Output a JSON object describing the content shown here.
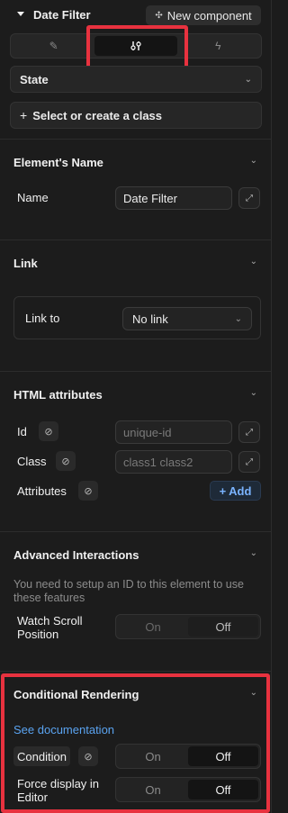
{
  "header": {
    "title": "Date Filter",
    "new_component_label": "New component",
    "new_component_icon": "sparkle-icon"
  },
  "tabs": [
    {
      "icon": "pencil-icon",
      "glyph": "✎",
      "active": false
    },
    {
      "icon": "sliders-icon",
      "glyph": "⫶",
      "active": true
    },
    {
      "icon": "lightning-icon",
      "glyph": "ϟ",
      "active": false
    }
  ],
  "state_select": {
    "label": "State"
  },
  "class_select": {
    "plus": "+",
    "label": "Select or create a class"
  },
  "element_name": {
    "title": "Element's Name",
    "name_label": "Name",
    "name_value": "Date Filter"
  },
  "link": {
    "title": "Link",
    "link_to_label": "Link to",
    "link_to_value": "No link"
  },
  "html_attributes": {
    "title": "HTML attributes",
    "id_label": "Id",
    "id_placeholder": "unique-id",
    "class_label": "Class",
    "class_placeholder": "class1 class2",
    "attributes_label": "Attributes",
    "add_label": "Add",
    "add_plus": "+"
  },
  "advanced": {
    "title": "Advanced Interactions",
    "note": "You need to setup an ID to this element to use these features",
    "watch_scroll_label": "Watch Scroll Position",
    "watch_scroll_on": "On",
    "watch_scroll_off": "Off",
    "watch_scroll_selected": "Off"
  },
  "conditional": {
    "title": "Conditional Rendering",
    "doc_link": "See documentation",
    "condition_label": "Condition",
    "condition_on": "On",
    "condition_off": "Off",
    "condition_selected": "Off",
    "force_label": "Force display in Editor",
    "force_on": "On",
    "force_off": "Off",
    "force_selected": "Off"
  },
  "colors": {
    "highlight_box": "#e8323f",
    "link": "#5aa3f0",
    "add_button_text": "#7ab3ff"
  }
}
